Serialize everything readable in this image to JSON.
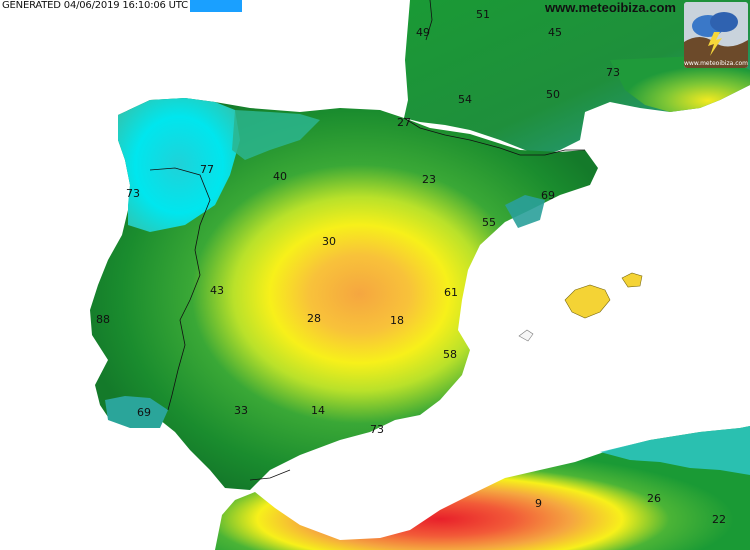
{
  "header": {
    "generated": "GENERATED 04/06/2019 16:10:06 UTC",
    "accent_color": "#1aa0ff"
  },
  "branding": {
    "site": "www.meteoibiza.com",
    "logo_caption": "www.meteoibiza.com",
    "logo_icon": "storm-cloud-icon"
  },
  "legend_colors": {
    "low": "#ffffff",
    "cyan": "#00e0e8",
    "teal": "#25b5a8",
    "green": "#1a9a35",
    "yellow": "#f7f01a",
    "orange": "#f5a640",
    "red": "#e8202a"
  },
  "values": [
    {
      "id": "v51",
      "text": "51"
    },
    {
      "id": "v45",
      "text": "45"
    },
    {
      "id": "v49",
      "text": "49"
    },
    {
      "id": "v73a",
      "text": "73"
    },
    {
      "id": "v54",
      "text": "54"
    },
    {
      "id": "v50",
      "text": "50"
    },
    {
      "id": "v27",
      "text": "27"
    },
    {
      "id": "v77",
      "text": "77"
    },
    {
      "id": "v40",
      "text": "40"
    },
    {
      "id": "v23",
      "text": "23"
    },
    {
      "id": "v69a",
      "text": "69"
    },
    {
      "id": "v73b",
      "text": "73"
    },
    {
      "id": "v55",
      "text": "55"
    },
    {
      "id": "v30",
      "text": "30"
    },
    {
      "id": "v43",
      "text": "43"
    },
    {
      "id": "v61",
      "text": "61"
    },
    {
      "id": "v88",
      "text": "88"
    },
    {
      "id": "v28",
      "text": "28"
    },
    {
      "id": "v18",
      "text": "18"
    },
    {
      "id": "v58",
      "text": "58"
    },
    {
      "id": "v69b",
      "text": "69"
    },
    {
      "id": "v33",
      "text": "33"
    },
    {
      "id": "v14",
      "text": "14"
    },
    {
      "id": "v73c",
      "text": "73"
    },
    {
      "id": "v9",
      "text": "9"
    },
    {
      "id": "v26",
      "text": "26"
    },
    {
      "id": "v22",
      "text": "22"
    }
  ]
}
